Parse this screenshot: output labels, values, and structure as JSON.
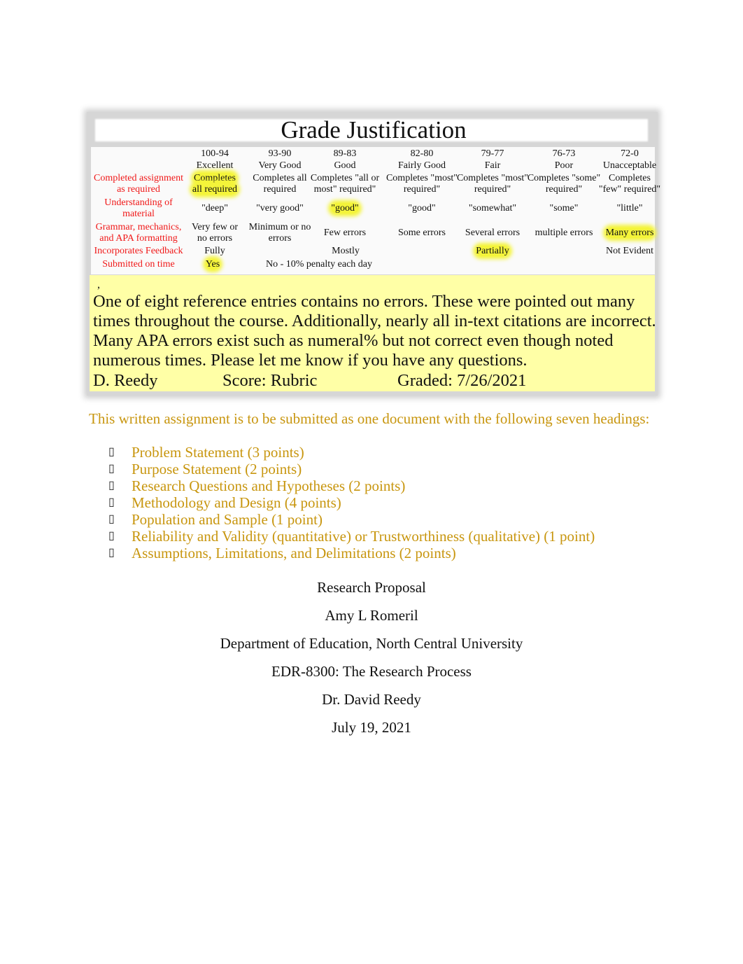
{
  "rubric": {
    "title": "Grade Justification",
    "columns": [
      {
        "range": "100-94",
        "grade": "Excellent"
      },
      {
        "range": "93-90",
        "grade": "Very Good"
      },
      {
        "range": "89-83",
        "grade": "Good"
      },
      {
        "range": "82-80",
        "grade": "Fairly Good"
      },
      {
        "range": "79-77",
        "grade": "Fair"
      },
      {
        "range": "76-73",
        "grade": "Poor"
      },
      {
        "range": "72-0",
        "grade": "Unacceptable"
      }
    ],
    "rows": [
      {
        "label": [
          "Completed assignment",
          "as required"
        ],
        "cells": [
          [
            "Completes",
            "all required"
          ],
          [
            "Completes all",
            "required"
          ],
          [
            "Completes \"all or",
            "most\" required\""
          ],
          [
            "Completes \"most\"",
            "required\""
          ],
          [
            "Completes \"most\"",
            "required\""
          ],
          [
            "Completes \"some\"",
            "required\""
          ],
          [
            "Completes",
            "\"few\" required\""
          ]
        ]
      },
      {
        "label": [
          "Understanding of",
          "material"
        ],
        "cells": [
          "\"deep\"",
          "\"very good\"",
          "\"good\"",
          "\"good\"",
          "\"somewhat\"",
          "\"some\"",
          "\"little\""
        ]
      },
      {
        "label": [
          "Grammar, mechanics,",
          "and APA formatting"
        ],
        "cells": [
          [
            "Very few or",
            "no errors"
          ],
          [
            "Minimum or no",
            "errors"
          ],
          "Few errors",
          "Some errors",
          "Several errors",
          "multiple errors",
          "Many errors"
        ]
      },
      {
        "label": "Incorporates Feedback",
        "cells": {
          "c1": "Fully",
          "c3": "Mostly",
          "c5": "Partially",
          "c7": "Not Evident"
        }
      },
      {
        "label": "Submitted on time",
        "cells": {
          "c1": "Yes",
          "late": "No - 10% penalty each day"
        }
      }
    ]
  },
  "comment": {
    "mark": ",",
    "lines": [
      "One of eight reference entries contains no errors. These were pointed out many",
      "times throughout the course. Additionally, nearly all in-text citations are incorrect.",
      "Many APA errors exist such as numeral% but not correct even though noted",
      "numerous times. Please let me know if you have any questions."
    ],
    "grader": "D. Reedy",
    "score": "Score: Rubric",
    "graded": "Graded: 7/26/2021"
  },
  "instructions": {
    "intro": "This written assignment is to be submitted as one document with the following seven headings:",
    "bullet_icon": "missing-glyph-box",
    "headings": [
      "Problem Statement (3 points)",
      "Purpose Statement (2 points)",
      "Research Questions and Hypotheses (2 points)",
      "Methodology and Design (4 points)",
      "Population and Sample (1 point)",
      "Reliability and Validity (quantitative) or Trustworthiness (qualitative) (1 point)",
      "Assumptions, Limitations, and Delimitations (2 points)"
    ]
  },
  "title_page": [
    "Research Proposal",
    "Amy L Romeril",
    "Department of Education, North Central University",
    "EDR-8300: The Research Process",
    "Dr. David Reedy",
    "July 19, 2021"
  ],
  "colors": {
    "label_red": "#f01818",
    "highlight": "#f4f43a",
    "comment_bg": "#ffffa6",
    "instruction_gold": "#c8960f"
  }
}
